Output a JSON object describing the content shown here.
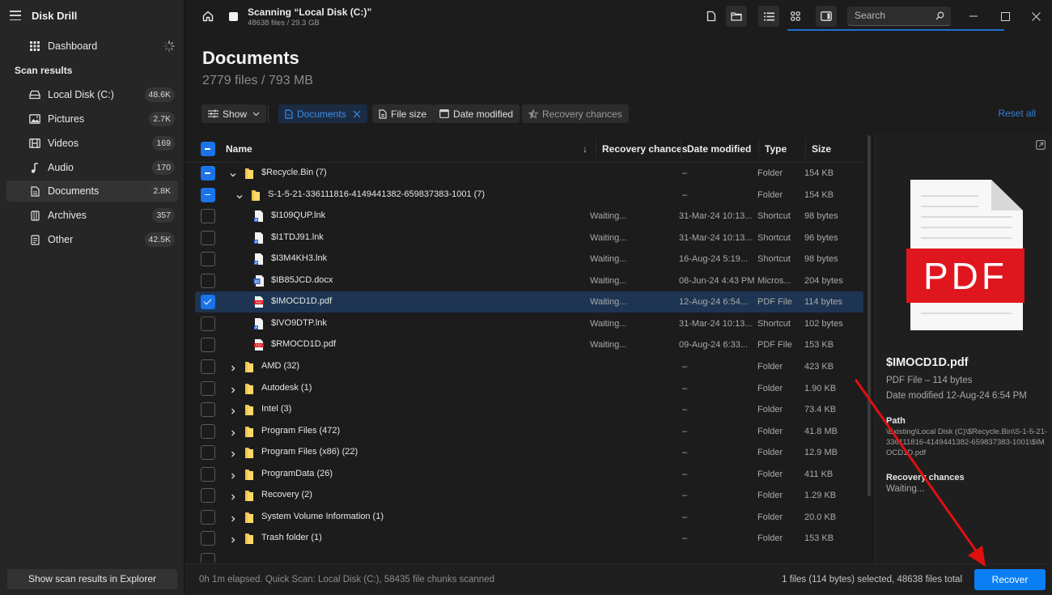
{
  "app": {
    "title": "Disk Drill"
  },
  "sidebar": {
    "dashboard_label": "Dashboard",
    "section_title": "Scan results",
    "items": [
      {
        "label": "Local Disk (C:)",
        "count": "48.6K",
        "icon": "drive-icon"
      },
      {
        "label": "Pictures",
        "count": "2.7K",
        "icon": "picture-icon"
      },
      {
        "label": "Videos",
        "count": "169",
        "icon": "film-icon"
      },
      {
        "label": "Audio",
        "count": "170",
        "icon": "music-note-icon"
      },
      {
        "label": "Documents",
        "count": "2.8K",
        "icon": "document-icon",
        "active": true
      },
      {
        "label": "Archives",
        "count": "357",
        "icon": "archive-icon"
      },
      {
        "label": "Other",
        "count": "42.5K",
        "icon": "file-other-icon"
      }
    ],
    "footer_button": "Show scan results in Explorer"
  },
  "topbar": {
    "scan_title": "Scanning “Local Disk (C:)”",
    "scan_subtitle": "48638 files / 29.3 GB",
    "search_placeholder": "Search"
  },
  "header": {
    "title": "Documents",
    "subtitle": "2779 files / 793 MB"
  },
  "filters": {
    "show_label": "Show",
    "documents_label": "Documents",
    "file_size_label": "File size",
    "date_modified_label": "Date modified",
    "recovery_chances_label": "Recovery chances",
    "reset_all_label": "Reset all"
  },
  "table": {
    "columns": {
      "name": "Name",
      "sort_indicator": "↓",
      "recovery": "Recovery chances",
      "date": "Date modified",
      "type": "Type",
      "size": "Size"
    },
    "rows": [
      {
        "name": "$Recycle.Bin (7)",
        "recovery": "",
        "date": "–",
        "type": "Folder",
        "size": "154 KB"
      },
      {
        "name": "S-1-5-21-336111816-4149441382-659837383-1001 (7)",
        "recovery": "",
        "date": "–",
        "type": "Folder",
        "size": "154 KB"
      },
      {
        "name": "$I109QUP.lnk",
        "recovery": "Waiting...",
        "date": "31-Mar-24 10:13...",
        "type": "Shortcut",
        "size": "98 bytes"
      },
      {
        "name": "$I1TDJ91.lnk",
        "recovery": "Waiting...",
        "date": "31-Mar-24 10:13...",
        "type": "Shortcut",
        "size": "96 bytes"
      },
      {
        "name": "$I3M4KH3.lnk",
        "recovery": "Waiting...",
        "date": "16-Aug-24 5:19...",
        "type": "Shortcut",
        "size": "98 bytes"
      },
      {
        "name": "$IB85JCD.docx",
        "recovery": "Waiting...",
        "date": "08-Jun-24 4:43 PM",
        "type": "Micros...",
        "size": "204 bytes"
      },
      {
        "name": "$IMOCD1D.pdf",
        "recovery": "Waiting...",
        "date": "12-Aug-24 6:54...",
        "type": "PDF File",
        "size": "114 bytes"
      },
      {
        "name": "$IVO9DTP.lnk",
        "recovery": "Waiting...",
        "date": "31-Mar-24 10:13...",
        "type": "Shortcut",
        "size": "102 bytes"
      },
      {
        "name": "$RMOCD1D.pdf",
        "recovery": "Waiting...",
        "date": "09-Aug-24 6:33...",
        "type": "PDF File",
        "size": "153 KB"
      },
      {
        "name": "AMD (32)",
        "recovery": "",
        "date": "–",
        "type": "Folder",
        "size": "423 KB"
      },
      {
        "name": "Autodesk (1)",
        "recovery": "",
        "date": "–",
        "type": "Folder",
        "size": "1.90 KB"
      },
      {
        "name": "Intel (3)",
        "recovery": "",
        "date": "–",
        "type": "Folder",
        "size": "73.4 KB"
      },
      {
        "name": "Program Files (472)",
        "recovery": "",
        "date": "–",
        "type": "Folder",
        "size": "41.8 MB"
      },
      {
        "name": "Program Files (x86) (22)",
        "recovery": "",
        "date": "–",
        "type": "Folder",
        "size": "12.9 MB"
      },
      {
        "name": "ProgramData (26)",
        "recovery": "",
        "date": "–",
        "type": "Folder",
        "size": "411 KB"
      },
      {
        "name": "Recovery (2)",
        "recovery": "",
        "date": "–",
        "type": "Folder",
        "size": "1.29 KB"
      },
      {
        "name": "System Volume Information (1)",
        "recovery": "",
        "date": "–",
        "type": "Folder",
        "size": "20.0 KB"
      },
      {
        "name": "Trash folder (1)",
        "recovery": "",
        "date": "–",
        "type": "Folder",
        "size": "153 KB"
      }
    ]
  },
  "details": {
    "preview_label": "PDF",
    "name": "$IMOCD1D.pdf",
    "type_size": "PDF File – 114 bytes",
    "date_modified": "Date modified 12-Aug-24 6:54 PM",
    "path_label": "Path",
    "path": "\\Existing\\Local Disk (C)\\$Recycle.Bin\\S-1-5-21-336111816-4149441382-659837383-1001\\$IMOCD1D.pdf",
    "recovery_label": "Recovery chances",
    "recovery_value": "Waiting..."
  },
  "status": {
    "left": "0h 1m elapsed. Quick Scan: Local Disk (C:), 58435 file chunks scanned",
    "right": "1 files (114 bytes) selected, 48638 files total",
    "recover_label": "Recover"
  },
  "colors": {
    "accent": "#0a7ef5",
    "selected_row": "#1d3552",
    "annotation_arrow": "#e01010",
    "pdf_red": "#e0161e"
  }
}
